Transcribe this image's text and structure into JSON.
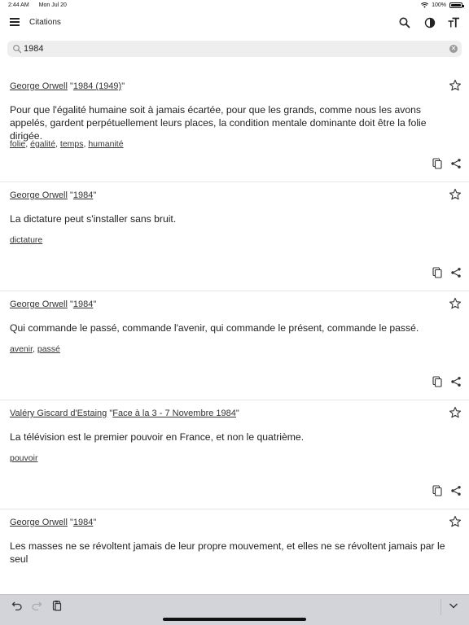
{
  "status_bar": {
    "time": "2:44 AM",
    "date": "Mon Jul 20",
    "battery": "100%",
    "battery_level": 1.0
  },
  "app_bar": {
    "title": "Citations",
    "icons": [
      "menu-icon",
      "search-icon",
      "contrast-icon",
      "text-size-icon"
    ]
  },
  "search": {
    "value": "1984",
    "placeholder": ""
  },
  "quotes": [
    {
      "author": "George Orwell",
      "source": "1984 (1949)",
      "text": "Pour que l'égalité humaine soit à jamais écartée, pour que les grands, comme nous les avons appelés, gardent perpétuellement leurs places, la condition mentale dominante doit être la folie dirigée.",
      "tags": [
        "folie",
        "égalité",
        "temps",
        "humanité"
      ]
    },
    {
      "author": "George Orwell",
      "source": "1984",
      "text": "La dictature peut s'installer sans bruit.",
      "tags": [
        "dictature"
      ]
    },
    {
      "author": "George Orwell",
      "source": "1984",
      "text": "Qui commande le passé, commande l'avenir, qui commande le présent, commande le passé.",
      "tags": [
        "avenir",
        "passé"
      ]
    },
    {
      "author": "Valéry Giscard d'Estaing",
      "source": "Face à la 3 - 7 Novembre 1984",
      "text": "La télévision est le premier pouvoir en France, et non le quatrième.",
      "tags": [
        "pouvoir"
      ]
    },
    {
      "author": "George Orwell",
      "source": "1984",
      "text": "Les masses ne se révoltent jamais de leur propre mouvement, et elles ne se révoltent jamais par le seul",
      "tags": []
    }
  ],
  "keyboard_toolbar": {
    "icons": [
      "undo-icon",
      "redo-icon",
      "paste-icon",
      "hide-keyboard-icon"
    ]
  }
}
